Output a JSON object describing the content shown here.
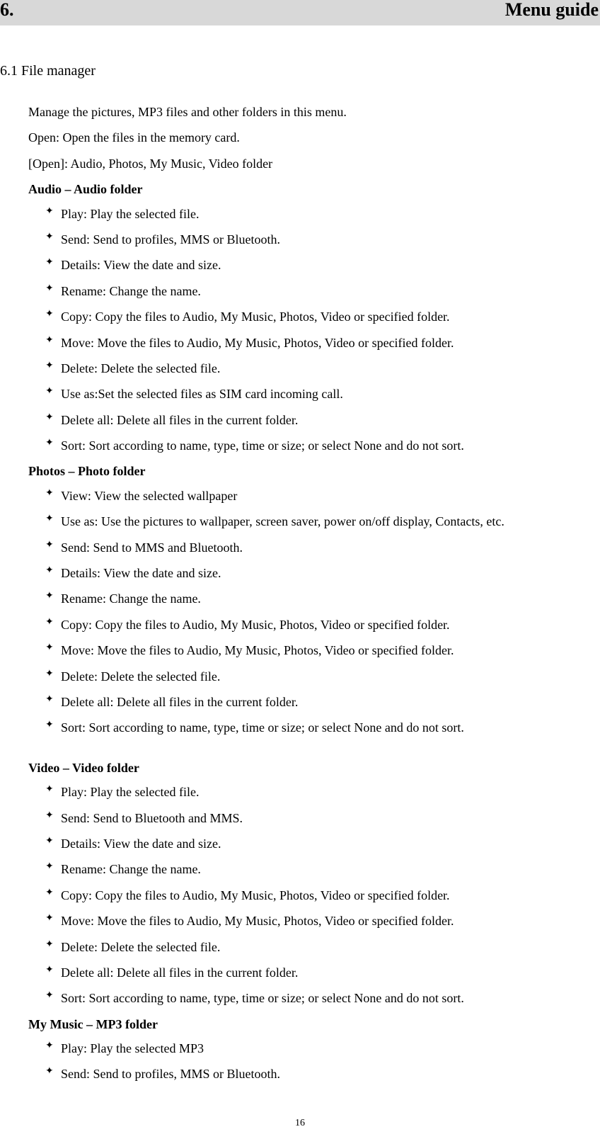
{
  "chapter": {
    "number": "6.",
    "title": "Menu guide"
  },
  "section": {
    "heading": "6.1 File manager"
  },
  "intro": [
    "Manage the pictures, MP3 files and other folders in this menu.",
    "Open: Open the files in the memory card.",
    "[Open]: Audio, Photos, My Music, Video folder"
  ],
  "folders": [
    {
      "title": "Audio – Audio folder",
      "items": [
        "Play: Play the selected file.",
        "Send: Send to profiles, MMS or Bluetooth.",
        "Details: View the date and size.",
        "Rename: Change the name.",
        "Copy: Copy the files to Audio, My Music, Photos, Video or specified folder.",
        "Move: Move the files to Audio, My Music, Photos, Video or specified folder.",
        "Delete: Delete the selected file.",
        "Use as:Set the selected files as SIM card incoming call.",
        "Delete all: Delete all files in the current folder.",
        "Sort: Sort according to name, type, time or size; or select None and do not sort."
      ]
    },
    {
      "title": "Photos – Photo folder",
      "items": [
        "View: View the selected wallpaper",
        "Use as: Use the pictures to wallpaper, screen saver, power on/off display, Contacts, etc.",
        "Send: Send to MMS and Bluetooth.",
        "Details: View the date and size.",
        "Rename: Change the name.",
        "Copy: Copy the files to Audio, My Music, Photos, Video or specified folder.",
        "Move: Move the files to Audio, My Music, Photos, Video or specified folder.",
        "Delete: Delete the selected file.",
        "Delete all: Delete all files in the current folder.",
        "Sort: Sort according to name, type, time or size; or select None and do not sort."
      ]
    },
    {
      "title": "Video – Video folder",
      "spacerBefore": true,
      "items": [
        "Play: Play the selected file.",
        "Send: Send to Bluetooth and MMS.",
        "Details: View the date and size.",
        "Rename: Change the name.",
        "Copy: Copy the files to Audio, My Music, Photos, Video or specified folder.",
        "Move: Move the files to Audio, My Music, Photos, Video or specified folder.",
        "Delete: Delete the selected file.",
        "Delete all: Delete all files in the current folder.",
        "Sort: Sort according to name, type, time or size; or select None and do not sort."
      ]
    },
    {
      "title": "My Music – MP3 folder",
      "items": [
        "Play: Play the selected MP3",
        "Send: Send to profiles, MMS or Bluetooth."
      ]
    }
  ],
  "pageNumber": "16"
}
